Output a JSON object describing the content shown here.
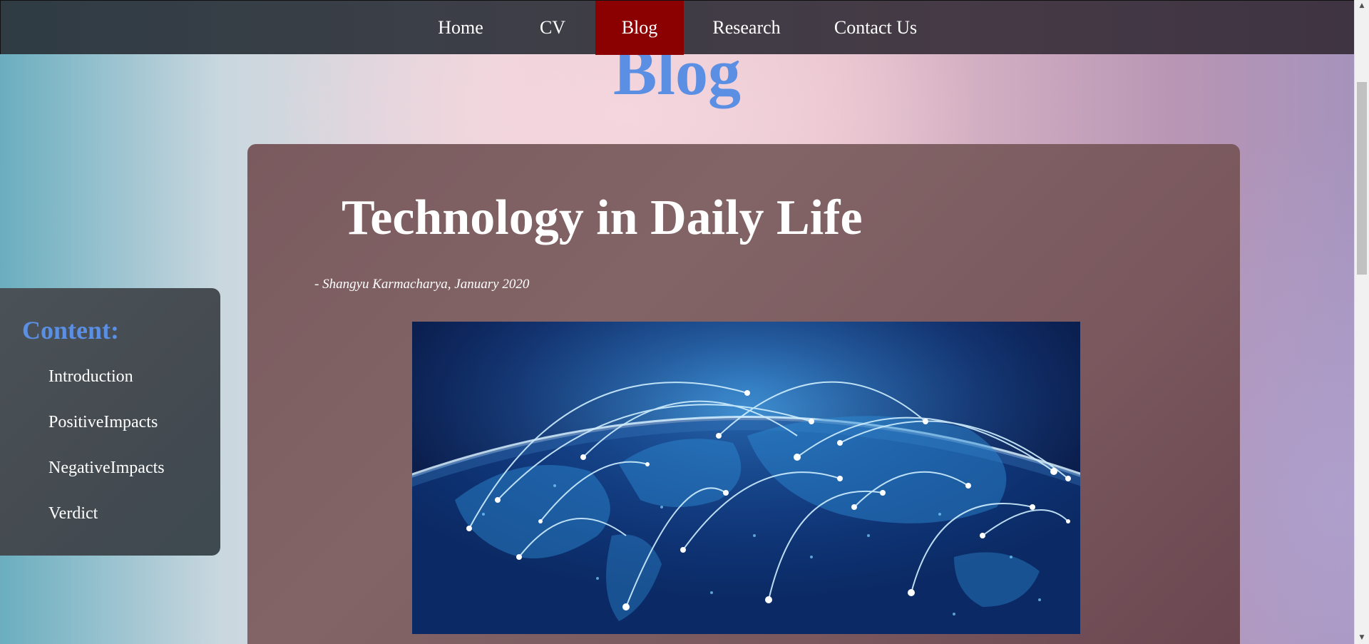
{
  "nav": {
    "items": [
      {
        "label": "Home",
        "active": false
      },
      {
        "label": "CV",
        "active": false
      },
      {
        "label": "Blog",
        "active": true
      },
      {
        "label": "Research",
        "active": false
      },
      {
        "label": "Contact Us",
        "active": false
      }
    ],
    "active_color": "#8b0000"
  },
  "page": {
    "heading": "Blog",
    "heading_color": "#5b8fe3"
  },
  "article": {
    "title": "Technology in Daily Life",
    "byline": "- Shangyu Karmacharya, January 2020",
    "image_icon": "globe-network-image"
  },
  "sidebar": {
    "heading": "Content:",
    "links": [
      "Introduction",
      "PositiveImpacts",
      "NegativeImpacts",
      "Verdict"
    ]
  },
  "scrollbar": {
    "up_icon": "arrow-up-icon",
    "down_icon": "arrow-down-icon"
  }
}
